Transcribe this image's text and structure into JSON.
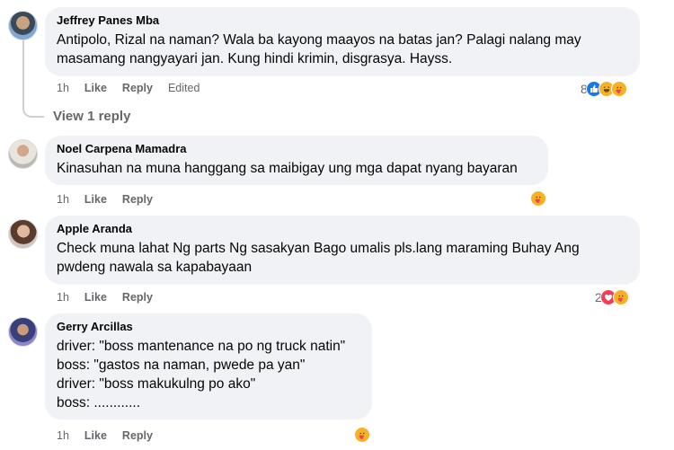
{
  "comments": [
    {
      "author": "Jeffrey Panes Mba",
      "text": "Antipolo, Rizal na naman? Wala ba kayong maayos na batas jan? Palagi nalang may\nmasamang nangyayari jan. Kung hindi krimin, disgrasya. Hayss.",
      "time": "1h",
      "like": "Like",
      "reply": "Reply",
      "edited": "Edited",
      "reaction_count": "8",
      "reactions": [
        "like-icon",
        "haha-icon",
        "care-icon"
      ],
      "view_replies": "View 1 reply"
    },
    {
      "author": "Noel Carpena Mamadra",
      "text": "Kinasuhan na muna hanggang sa maibigay ung mga dapat nyang bayaran",
      "time": "1h",
      "like": "Like",
      "reply": "Reply",
      "reactions": [
        "care-icon"
      ]
    },
    {
      "author": "Apple Aranda",
      "text": "Check muna lahat Ng parts Ng sasakyan Bago umalis pls.lang maraming Buhay Ang\npwdeng nawala sa kapabayaan",
      "time": "1h",
      "like": "Like",
      "reply": "Reply",
      "reaction_count": "2",
      "reactions": [
        "love-icon",
        "care-icon"
      ]
    },
    {
      "author": "Gerry Arcillas",
      "text": "driver: \"boss mantenance na po ng truck natin\"\nboss: \"gastos na naman, pwede pa yan\"\ndriver: \"boss makukulng po ako\"\nboss: ............",
      "time": "1h",
      "like": "Like",
      "reply": "Reply",
      "reactions": [
        "care-icon"
      ]
    }
  ],
  "colors": {
    "bubble": "#f0f2f5",
    "meta_text": "#65676b",
    "like_blue": "#1877f2",
    "love_red": "#f33e58",
    "haha_yellow": "#f7b125"
  }
}
